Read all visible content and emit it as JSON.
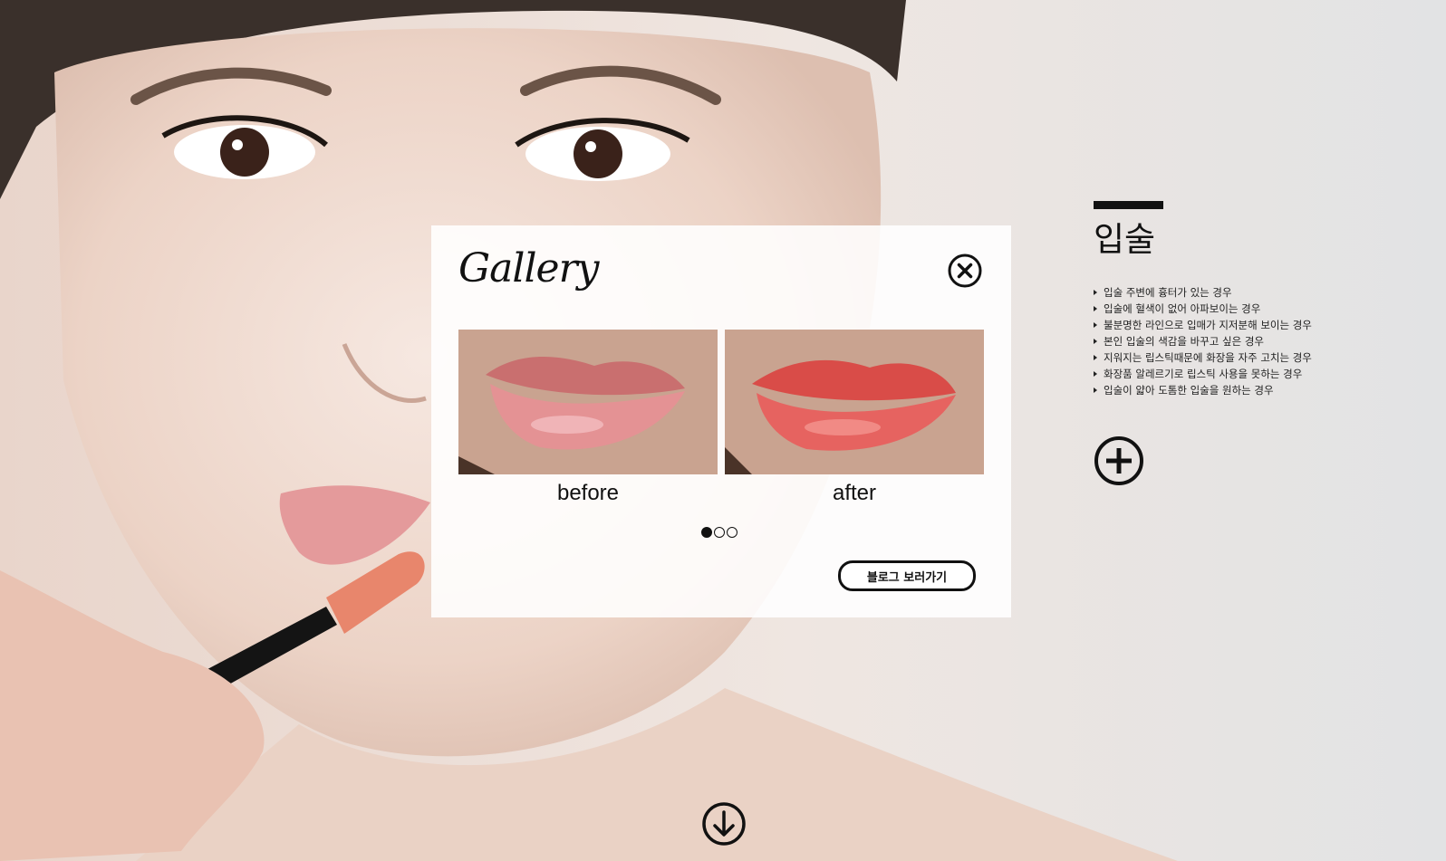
{
  "gallery": {
    "title": "Gallery",
    "before_label": "before",
    "after_label": "after",
    "blog_button": "블로그 보러가기",
    "slide_count": 3,
    "active_slide": 1
  },
  "side": {
    "title": "입술",
    "items": [
      "입술 주변에 흉터가 있는 경우",
      "입술에 혈색이 없어 아파보이는 경우",
      "불분명한 라인으로 입매가 지저분해 보이는 경우",
      "본인 입술의 색감을 바꾸고 싶은 경우",
      "지워지는 립스틱때문에 화장을 자주 고치는 경우",
      "화장품 알레르기로 립스틱 사용을 못하는 경우",
      "입술이 얇아 도톰한 입술을 원하는 경우"
    ]
  },
  "icons": {
    "close": "close-circle-icon",
    "plus": "plus-circle-icon",
    "down": "arrow-down-circle-icon"
  },
  "colors": {
    "ink": "#111111",
    "lip_before": "#d9868a",
    "lip_after": "#e0514e"
  }
}
